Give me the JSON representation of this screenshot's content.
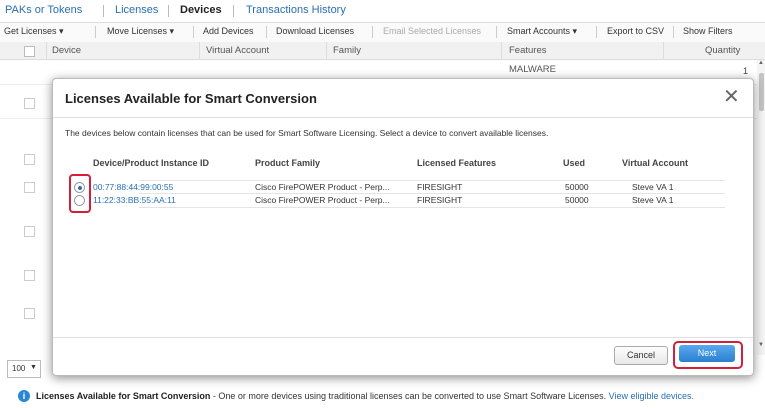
{
  "tabs": [
    {
      "label": "PAKs or Tokens"
    },
    {
      "label": "Licenses"
    },
    {
      "label": "Devices",
      "active": true
    },
    {
      "label": "Transactions History"
    }
  ],
  "toolbar": {
    "get_licenses": "Get Licenses ▾",
    "move_licenses": "Move Licenses ▾",
    "add_devices": "Add Devices",
    "download_licenses": "Download Licenses",
    "email_selected": "Email Selected Licenses",
    "smart_accounts": "Smart Accounts ▾",
    "export_csv": "Export to CSV",
    "show_filters": "Show Filters"
  },
  "table": {
    "headers": [
      "Device",
      "Virtual Account",
      "Family",
      "Features",
      "Quantity"
    ],
    "row1_features": "MALWARE",
    "row1_quantity": "1"
  },
  "pagination": {
    "page_size": "100"
  },
  "modal": {
    "title": "Licenses Available for Smart Conversion",
    "close": "✕",
    "description": "The devices below contain licenses that can be used for Smart Software Licensing. Select a device to convert available licenses.",
    "headers": {
      "device": "Device/Product Instance ID",
      "family": "Product Family",
      "features": "Licensed Features",
      "used": "Used",
      "va": "Virtual Account"
    },
    "rows": [
      {
        "device": "00:77:88:44:99:00:55",
        "family": "Cisco FirePOWER Product - Perp...",
        "features": "FIRESIGHT",
        "used": "50000",
        "va": "Steve VA 1",
        "selected": true
      },
      {
        "device": "11:22:33:BB:55:AA:11",
        "family": "Cisco FirePOWER Product - Perp...",
        "features": "FIRESIGHT",
        "used": "50000",
        "va": "Steve VA 1",
        "selected": false
      }
    ],
    "cancel_label": "Cancel",
    "next_label": "Next"
  },
  "footer": {
    "title": "Licenses Available for Smart Conversion",
    "text": " - One or more devices using traditional licenses can be converted to use Smart Software Licenses. ",
    "link": "View eligible devices."
  },
  "colors": {
    "link": "#2a6fb3",
    "highlight": "#d0203a",
    "primary_button": "#2a7fcf",
    "info": "#2a87d6"
  },
  "icons": {
    "info": "info-icon",
    "close": "close-icon",
    "dropdown": "chevron-down-icon"
  }
}
